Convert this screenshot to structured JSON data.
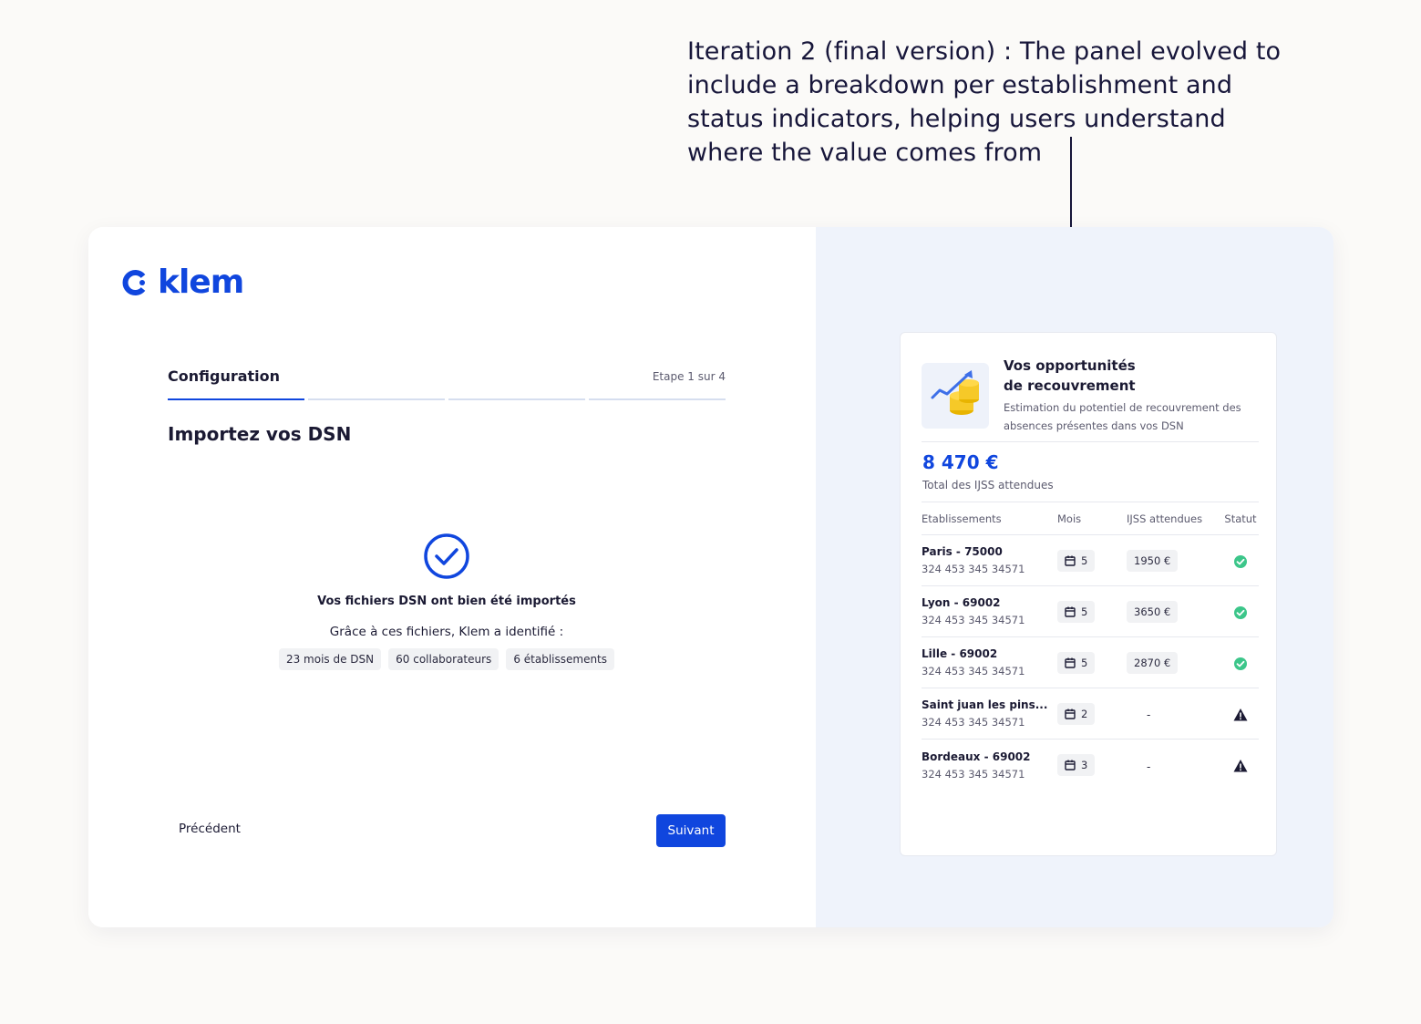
{
  "annotation": {
    "line1": "Iteration 2 (final version) : The panel evolved to",
    "line2": "include a breakdown per establishment and",
    "line3": "status indicators, helping users understand",
    "line4": "where the value comes from"
  },
  "brand": {
    "name": "klem",
    "color": "#1046de"
  },
  "wizard": {
    "step_title": "Configuration",
    "step_count": "Etape 1 sur 4",
    "progress_current_step": 1,
    "progress_total_steps": 4,
    "page_title": "Importez vos DSN",
    "success_message": "Vos fichiers DSN ont bien été importés",
    "success_sub": "Grâce à ces fichiers, Klem a identifié :",
    "chips": [
      "23 mois de DSN",
      "60 collaborateurs",
      "6 établissements"
    ],
    "prev_label": "Précédent",
    "next_label": "Suivant"
  },
  "panel": {
    "title_line1": "Vos opportunités",
    "title_line2": "de recouvrement",
    "description": "Estimation du potentiel de recouvrement des absences présentes dans vos DSN",
    "total_amount": "8 470 €",
    "total_label": "Total des IJSS attendues",
    "columns": [
      "Etablissements",
      "Mois",
      "IJSS attendues",
      "Statut"
    ],
    "rows": [
      {
        "name": "Paris - 75000",
        "id": "324 453 345 34571",
        "mois": "5",
        "ijss": "1950 €",
        "status": "ok"
      },
      {
        "name": "Lyon - 69002",
        "id": "324 453 345 34571",
        "mois": "5",
        "ijss": "3650 €",
        "status": "ok"
      },
      {
        "name": "Lille - 69002",
        "id": "324 453 345 34571",
        "mois": "5",
        "ijss": "2870 €",
        "status": "ok"
      },
      {
        "name": "Saint juan les pins...",
        "id": "324 453 345 34571",
        "mois": "2",
        "ijss": "-",
        "status": "warning"
      },
      {
        "name": "Bordeaux - 69002",
        "id": "324 453 345 34571",
        "mois": "3",
        "ijss": "-",
        "status": "warning"
      }
    ],
    "colors": {
      "ok": "#3cc68a",
      "warning": "#1b1a33",
      "accent": "#1046de"
    }
  }
}
